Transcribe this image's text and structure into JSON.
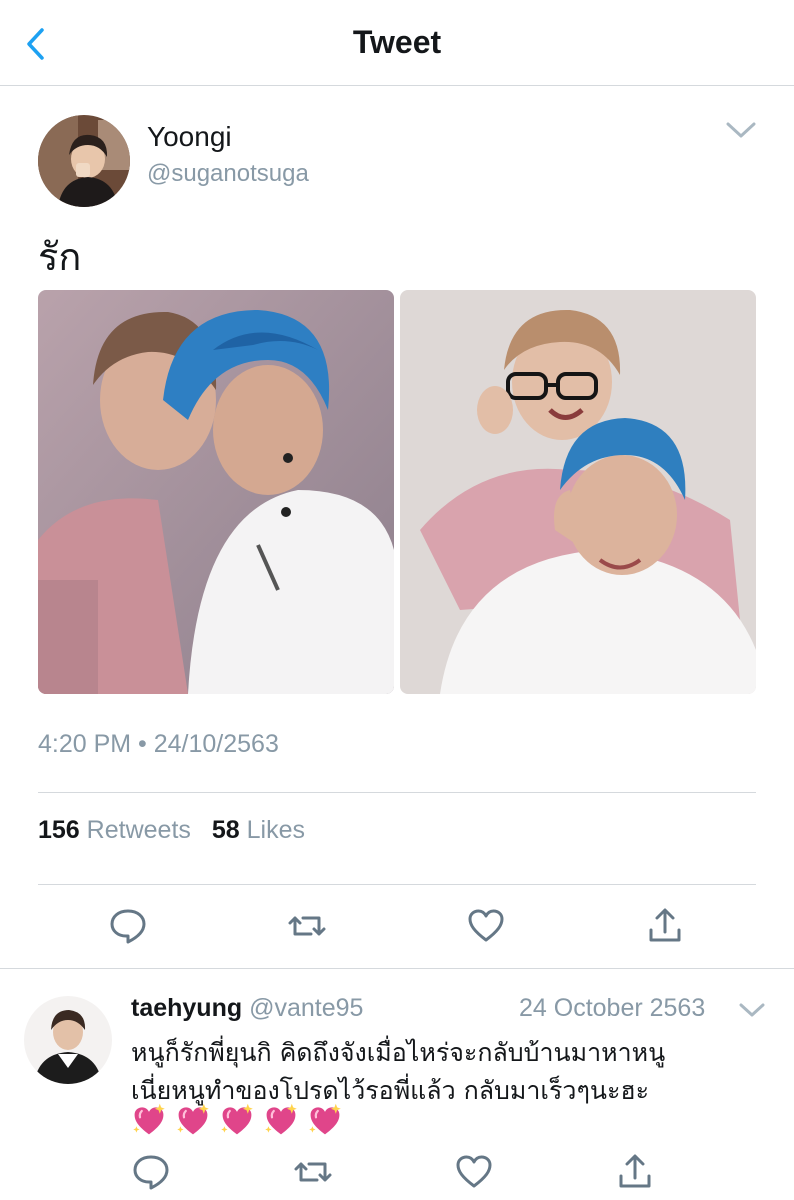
{
  "nav": {
    "title": "Tweet",
    "back_icon": "back-chevron-icon"
  },
  "tweet": {
    "author_name": "Yoongi",
    "author_handle": "@suganotsuga",
    "text": "รัก",
    "timestamp": "4:20 PM • 24/10/2563",
    "retweet_count": "156",
    "retweet_label": "Retweets",
    "like_count": "58",
    "like_label": "Likes",
    "photos": [
      "photo-blue-hair-duo",
      "photo-glasses-duo"
    ]
  },
  "actions": [
    "reply-icon",
    "retweet-icon",
    "like-icon",
    "share-icon"
  ],
  "reply": {
    "name": "taehyung",
    "handle": "@vante95",
    "date": "24 October 2563",
    "text_line1": "หนูก็รักพี่ยุนกิ คิดถึงจังเมื่อไหร่จะกลับบ้านมาหาหนู",
    "text_line2": "เนี่ยหนูทำของโปรดไว้รอพี่แล้ว กลับมาเร็วๆนะฮะ",
    "emoji_count": 5,
    "emoji_icon": "sparkling-heart-icon"
  },
  "colors": {
    "text": "#14171a",
    "secondary": "#8899a6",
    "accent": "#1da1f2",
    "divider": "#d5d9dd",
    "heart_emoji": "#e0458a"
  }
}
